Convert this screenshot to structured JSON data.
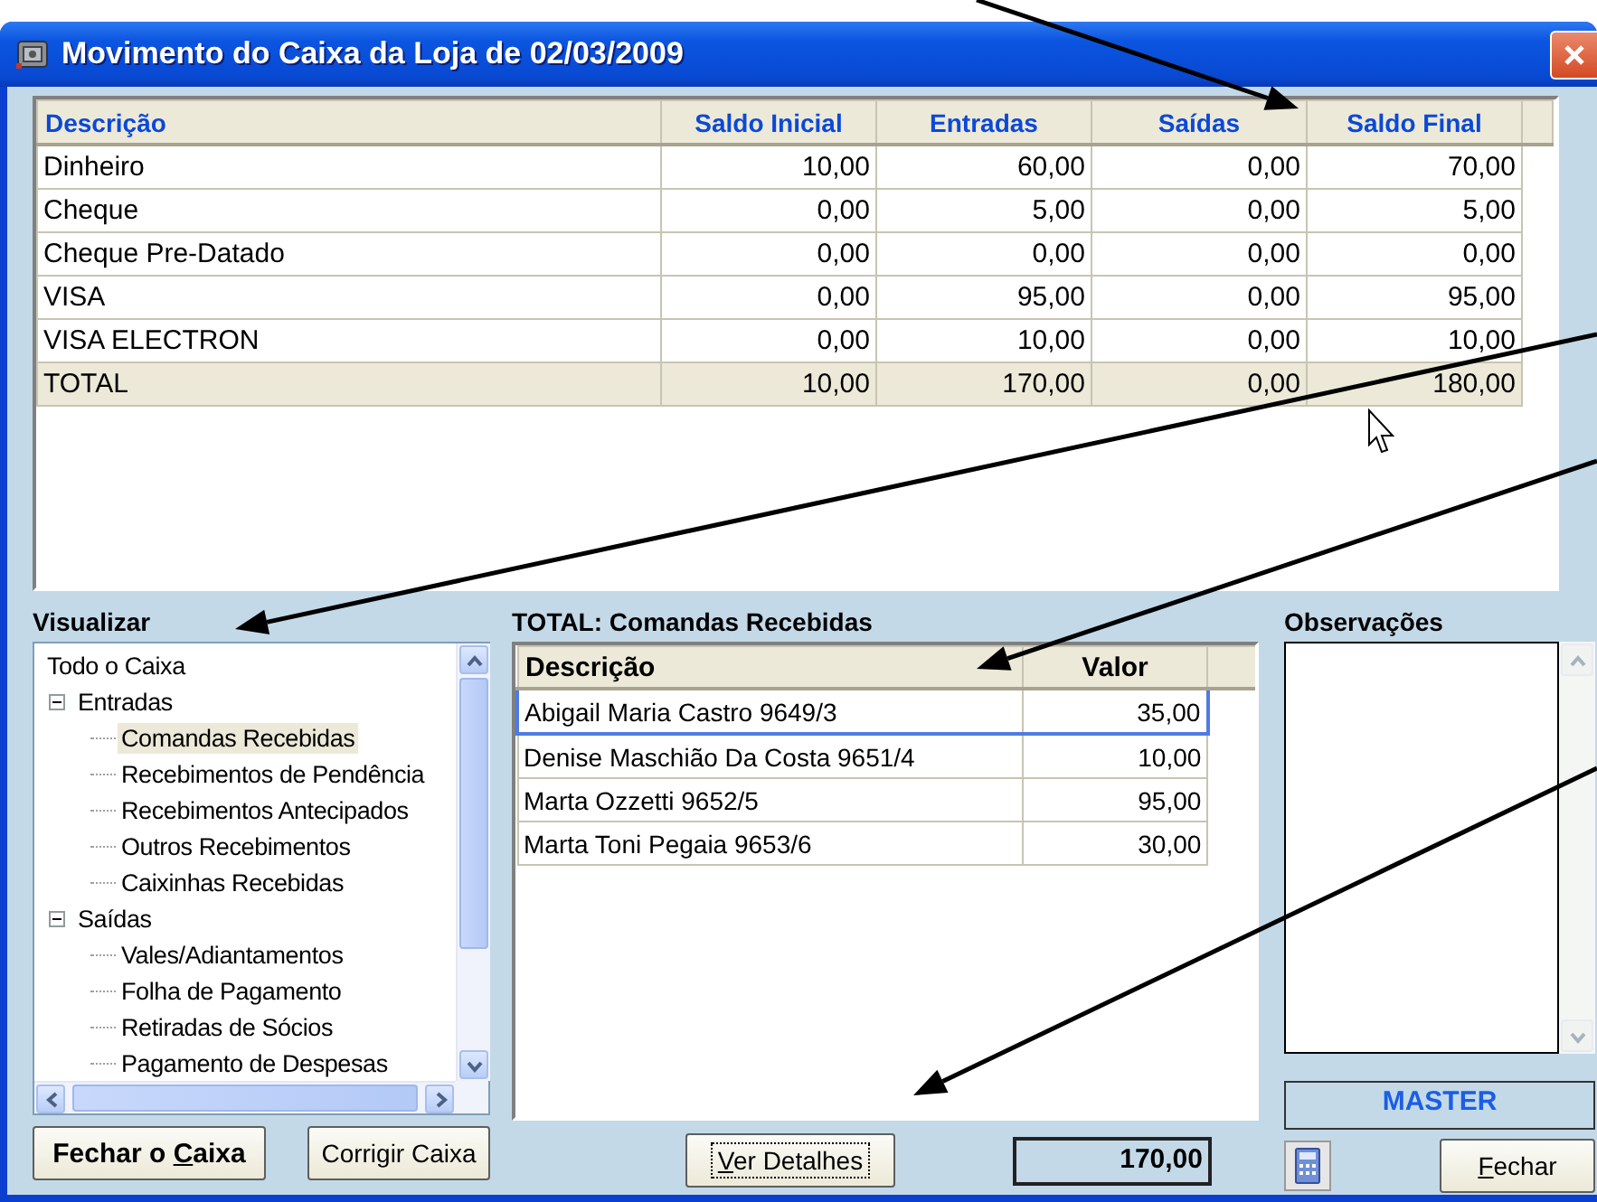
{
  "window": {
    "title": "Movimento do Caixa da Loja de 02/03/2009"
  },
  "summary_table": {
    "columns": [
      "Descrição",
      "Saldo Inicial",
      "Entradas",
      "Saídas",
      "Saldo Final"
    ],
    "rows": [
      {
        "kind": "item",
        "cells": [
          "Dinheiro",
          "10,00",
          "60,00",
          "0,00",
          "70,00"
        ]
      },
      {
        "kind": "item",
        "cells": [
          "Cheque",
          "0,00",
          "5,00",
          "0,00",
          "5,00"
        ]
      },
      {
        "kind": "item",
        "cells": [
          "Cheque Pre-Datado",
          "0,00",
          "0,00",
          "0,00",
          "0,00"
        ]
      },
      {
        "kind": "item",
        "cells": [
          "VISA",
          "0,00",
          "95,00",
          "0,00",
          "95,00"
        ]
      },
      {
        "kind": "item",
        "cells": [
          "VISA ELECTRON",
          "0,00",
          "10,00",
          "0,00",
          "10,00"
        ]
      },
      {
        "kind": "total",
        "cells": [
          "TOTAL",
          "10,00",
          "170,00",
          "0,00",
          "180,00"
        ]
      }
    ]
  },
  "view_panel": {
    "label": "Visualizar",
    "tree": [
      {
        "label": "Todo o Caixa",
        "selected": false
      },
      {
        "label": "Entradas",
        "selected": false,
        "expanded": true,
        "children": [
          {
            "label": "Comandas Recebidas",
            "selected": true
          },
          {
            "label": "Recebimentos de Pendência",
            "selected": false
          },
          {
            "label": "Recebimentos Antecipados",
            "selected": false
          },
          {
            "label": "Outros Recebimentos",
            "selected": false
          },
          {
            "label": "Caixinhas Recebidas",
            "selected": false
          }
        ]
      },
      {
        "label": "Saídas",
        "selected": false,
        "expanded": true,
        "children": [
          {
            "label": "Vales/Adiantamentos",
            "selected": false
          },
          {
            "label": "Folha de Pagamento",
            "selected": false
          },
          {
            "label": "Retiradas de Sócios",
            "selected": false
          },
          {
            "label": "Pagamento de Despesas",
            "selected": false
          }
        ]
      }
    ]
  },
  "detail_panel": {
    "title": "TOTAL: Comandas Recebidas",
    "columns": [
      "Descrição",
      "Valor"
    ],
    "rows": [
      {
        "selected": true,
        "cells": [
          "Abigail Maria Castro 9649/3",
          "35,00"
        ]
      },
      {
        "selected": false,
        "cells": [
          "Denise Maschião Da Costa 9651/4",
          "10,00"
        ]
      },
      {
        "selected": false,
        "cells": [
          "Marta Ozzetti 9652/5",
          "95,00"
        ]
      },
      {
        "selected": false,
        "cells": [
          "Marta Toni Pegaia 9653/6",
          "30,00"
        ]
      }
    ],
    "details_button": {
      "label_parts": [
        {
          "text": "V",
          "underlined": true
        },
        {
          "text": "er Detalhes",
          "underlined": false
        }
      ]
    },
    "total": "170,00"
  },
  "observations_panel": {
    "label": "Observações",
    "user": "MASTER"
  },
  "buttons": {
    "close_register": {
      "label_parts": [
        {
          "text": "Fechar o ",
          "underlined": false
        },
        {
          "text": "C",
          "underlined": true
        },
        {
          "text": "aixa",
          "underlined": false
        }
      ]
    },
    "correct_register": {
      "label_parts": [
        {
          "text": "Corrigir Caixa",
          "underlined": false
        }
      ]
    },
    "close": {
      "label_parts": [
        {
          "text": "F",
          "underlined": true
        },
        {
          "text": "echar",
          "underlined": false
        }
      ]
    }
  }
}
